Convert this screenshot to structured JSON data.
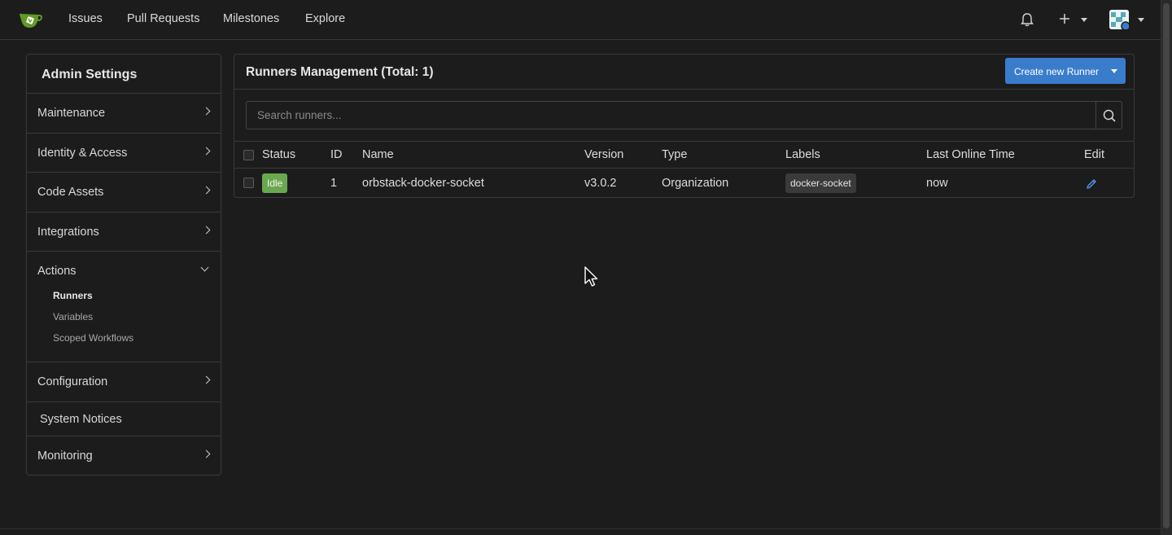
{
  "nav": {
    "links": [
      "Issues",
      "Pull Requests",
      "Milestones",
      "Explore"
    ]
  },
  "sidebar": {
    "title": "Admin Settings",
    "items": [
      {
        "label": "Maintenance"
      },
      {
        "label": "Identity & Access"
      },
      {
        "label": "Code Assets"
      },
      {
        "label": "Integrations"
      },
      {
        "label": "Actions",
        "subitems": [
          "Runners",
          "Variables",
          "Scoped Workflows"
        ],
        "active_subitem": "Runners"
      },
      {
        "label": "Configuration"
      },
      {
        "label": "System Notices"
      },
      {
        "label": "Monitoring"
      }
    ]
  },
  "main": {
    "title": "Runners Management (Total: 1)",
    "create_button": "Create new Runner",
    "search_placeholder": "Search runners...",
    "columns": [
      "Status",
      "ID",
      "Name",
      "Version",
      "Type",
      "Labels",
      "Last Online Time",
      "Edit"
    ],
    "rows": [
      {
        "status": "Idle",
        "id": "1",
        "name": "orbstack-docker-socket",
        "version": "v3.0.2",
        "type": "Organization",
        "label": "docker-socket",
        "last_online": "now"
      }
    ]
  },
  "colors": {
    "accent": "#3a7ccc",
    "status_idle": "#6aa84f",
    "background": "#1c1c1c"
  }
}
